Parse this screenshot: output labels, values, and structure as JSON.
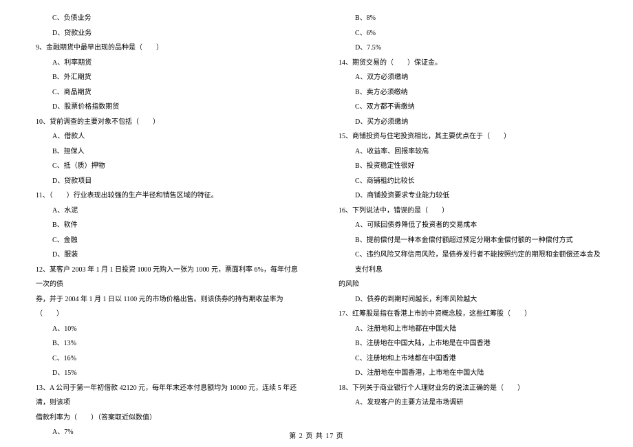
{
  "left": {
    "prevOptions": [
      "C、负债业务",
      "D、贷款业务"
    ],
    "q9": "9、金融期货中最早出现的品种是（　　）",
    "q9options": [
      "A、利率期货",
      "B、外汇期货",
      "C、商品期货",
      "D、股票价格指数期货"
    ],
    "q10": "10、贷前调查的主要对象不包括（　　）",
    "q10options": [
      "A、借款人",
      "B、担保人",
      "C、抵（质）押物",
      "D、贷款项目"
    ],
    "q11": "11、（　　）行业表现出较强的生产半径和销售区域的特征。",
    "q11options": [
      "A、水泥",
      "B、软件",
      "C、金融",
      "D、服装"
    ],
    "q12a": "12、某客户 2003 年 1 月 1 日投资 1000 元购入一张为 1000 元，票面利率 6%，每年付息一次的债",
    "q12b": "券，并于 2004 年 1 月 1 日以 1100 元的市场价格出售。则该债券的持有期收益率为（　　）",
    "q12options": [
      "A、10%",
      "B、13%",
      "C、16%",
      "D、15%"
    ],
    "q13a": "13、A 公司于第一年初借款 42120 元，每年年末还本付息额均为 10000 元，连续 5 年还清，则该项",
    "q13b": "借款利率为（　　）（答案取近似数值）",
    "q13options": [
      "A、7%"
    ]
  },
  "right": {
    "q13moreOptions": [
      "B、8%",
      "C、6%",
      "D、7.5%"
    ],
    "q14": "14、期货交易的（　　）保证金。",
    "q14options": [
      "A、双方必须缴纳",
      "B、卖方必须缴纳",
      "C、双方都不需缴纳",
      "D、买方必须缴纳"
    ],
    "q15": "15、商铺投资与住宅投资相比，其主要优点在于（　　）",
    "q15options": [
      "A、收益率、回报率较高",
      "B、投资稳定性很好",
      "C、商铺租约比较长",
      "D、商铺投资要求专业能力较低"
    ],
    "q16": "16、下列说法中，错误的是（　　）",
    "q16options": [
      "A、可赎回债券降低了投资者的交易成本",
      "B、提前偿付是一种本金偿付额超过预定分期本金偿付额的一种偿付方式",
      "C、违约风险又称信用风险，是债券发行者不能按照约定的期限和金额偿还本金及支付利息"
    ],
    "q16cont": "的风险",
    "q16optionsD": "D、债券的到期时间越长，利率风险越大",
    "q17": "17、红筹股是指在香港上市的中资概念股，这些红筹股（　　）",
    "q17options": [
      "A、注册地和上市地都在中国大陆",
      "B、注册地在中国大陆，上市地是在中国香港",
      "C、注册地和上市地都在中国香港",
      "D、注册地在中国香港，上市地在中国大陆"
    ],
    "q18": "18、下列关于商业银行个人理财业务的说法正确的是（　　）",
    "q18options": [
      "A、发现客户的主要方法是市场调研"
    ]
  },
  "footer": "第 2 页 共 17 页"
}
